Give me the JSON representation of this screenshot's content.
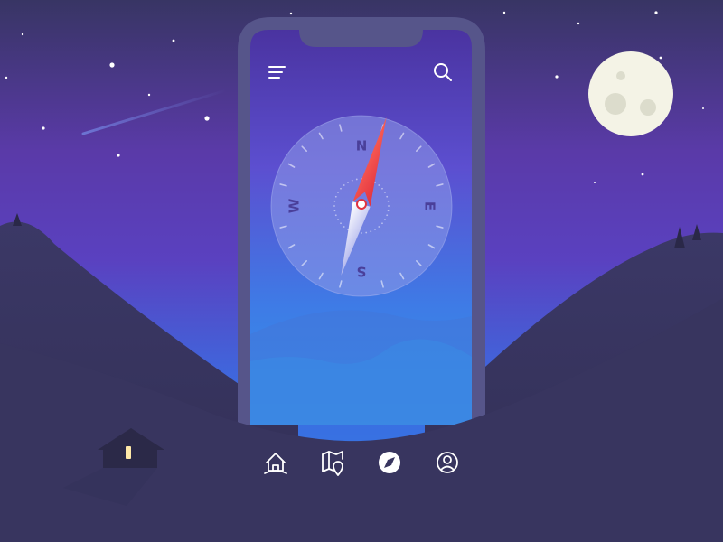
{
  "compass": {
    "north": "N",
    "east": "E",
    "south": "S",
    "west": "W",
    "needle_heading_deg": 16
  },
  "header": {
    "menu_icon": "hamburger-menu-icon",
    "search_icon": "search-icon"
  },
  "bottom_nav": {
    "items": [
      {
        "id": "home",
        "icon": "home-icon",
        "active": false
      },
      {
        "id": "map",
        "icon": "map-pin-icon",
        "active": false
      },
      {
        "id": "compass",
        "icon": "compass-icon",
        "active": true
      },
      {
        "id": "profile",
        "icon": "profile-icon",
        "active": false
      }
    ]
  },
  "colors": {
    "sky_top": "#3a3565",
    "sky_mid": "#6a3fb5",
    "sky_horizon": "#3e6fe0",
    "hills": "#3a3762",
    "moon": "#f4f3e6",
    "needle_north": "#ef4a4a",
    "cabin_window": "#ffe9a8"
  }
}
